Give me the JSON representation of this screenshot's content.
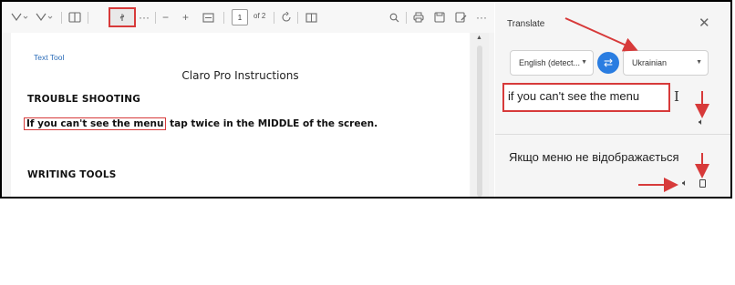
{
  "toolbar": {
    "read_aloud_label": "ꬷ",
    "more_label": "···",
    "zoom_out_label": "−",
    "zoom_in_label": "+",
    "page_number": "1",
    "page_of": "of 2"
  },
  "document": {
    "text_tool_label": "Text Tool",
    "title": "Claro Pro Instructions",
    "heading_troubleshooting": "TROUBLE SHOOTING",
    "highlighted_text": "If you can't see the menu",
    "body_rest": " tap twice in the MIDDLE of the screen.",
    "heading_writing_tools": "WRITING TOOLS"
  },
  "translate_panel": {
    "title": "Translate",
    "close_label": "✕",
    "source_language": "English (detect...",
    "target_language": "Ukrainian",
    "swap_label": "⇄",
    "source_text": "if you can't see the menu",
    "translated_text": "Якщо меню не відображається"
  },
  "colors": {
    "annotation_red": "#d73a3a",
    "accent_blue": "#2a7de1"
  }
}
